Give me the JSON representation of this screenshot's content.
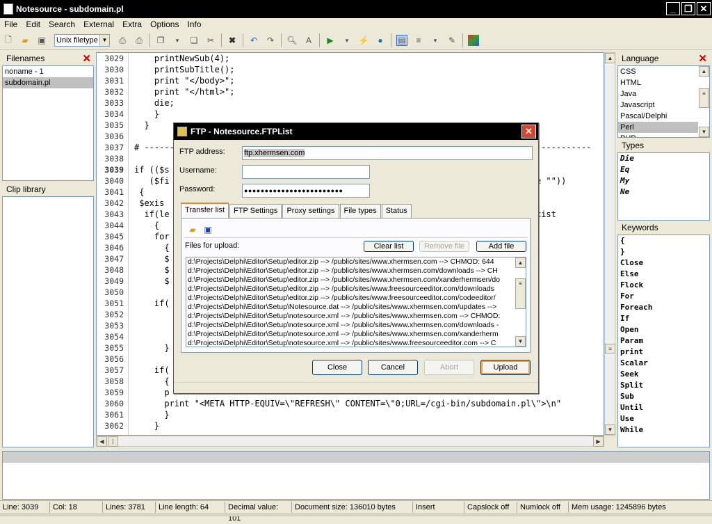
{
  "window": {
    "title": "Notesource - subdomain.pl"
  },
  "menu": [
    "File",
    "Edit",
    "Search",
    "External",
    "Extra",
    "Options",
    "Info"
  ],
  "toolbar": {
    "filetype": "Unix filetype"
  },
  "filenames": {
    "title": "Filenames",
    "items": [
      "noname - 1",
      "subdomain.pl"
    ],
    "selected": 1
  },
  "clip_library": {
    "title": "Clip library"
  },
  "language": {
    "title": "Language",
    "items": [
      "CSS",
      "HTML",
      "Java",
      "Javascript",
      "Pascal/Delphi",
      "Perl",
      "PHP"
    ],
    "selected": 5
  },
  "types": {
    "title": "Types",
    "items": [
      "Die",
      "Eq",
      "My",
      "Ne"
    ]
  },
  "keywords": {
    "title": "Keywords",
    "items": [
      "{",
      "}",
      "Close",
      "Else",
      "Flock",
      "For",
      "Foreach",
      "If",
      "Open",
      "Param",
      "print",
      "Scalar",
      "Seek",
      "Split",
      "Sub",
      "Until",
      "Use",
      "While"
    ]
  },
  "editor": {
    "line_numbers": [
      "3029",
      "3030",
      "3031",
      "3032",
      "3033",
      "3034",
      "3035",
      "3036",
      "3037",
      "3038",
      "3039",
      "3040",
      "3041",
      "3042",
      "3043",
      "3044",
      "3045",
      "3046",
      "3047",
      "3048",
      "3049",
      "3050",
      "3051",
      "3052",
      "3053",
      "3054",
      "3055",
      "3056",
      "3057",
      "3058",
      "3059",
      "3060",
      "3061",
      "3062"
    ],
    "lines": [
      "    printNewSub(4);",
      "    printSubTitle();",
      "    print \"</body>\";",
      "    print \"</html>\";",
      "    die;",
      "    }",
      "  }",
      "",
      "# -----------------------------------------------------------------------------------------",
      "",
      "if (($s                                                                                   ",
      "   ($fi                                                                    rto ne \"\"))",
      " {",
      " $exis",
      "  if(le                                                                 omain, exist",
      "    {",
      "    for",
      "      {",
      "      $",
      "      $",
      "      $",
      "",
      "    if(",
      "",
      "",
      "",
      "      }",
      "",
      "    if(",
      "      {",
      "      p",
      "      print \"<META HTTP-EQUIV=\\\"REFRESH\\\" CONTENT=\\\"0;URL=/cgi-bin/subdomain.pl\\\">\\n\"",
      "      }",
      "    }"
    ]
  },
  "status": {
    "line": "Line: 3039",
    "col": "Col: 18",
    "lines": "Lines: 3781",
    "line_length": "Line length: 64",
    "decimal": "Decimal value: 101",
    "doc_size": "Document size: 136010 bytes",
    "mode": "Insert",
    "capslock": "Capslock off",
    "numlock": "Numlock off",
    "mem": "Mem usage: 1245896 bytes"
  },
  "dialog": {
    "title": "FTP - Notesource.FTPList",
    "ftp_address_label": "FTP address:",
    "ftp_address_value": "ftp.xhermsen.com",
    "username_label": "Username:",
    "username_value": "",
    "password_label": "Password:",
    "password_value": "●●●●●●●●●●●●●●●●●●●●●●●●",
    "tabs": [
      "Transfer list",
      "FTP Settings",
      "Proxy settings",
      "File types",
      "Status"
    ],
    "files_label": "Files for upload:",
    "clear_list": "Clear list",
    "remove_file": "Remove file",
    "add_file": "Add file",
    "files": [
      "d:\\Projects\\Delphi\\Editor\\Setup\\editor.zip --> /public/sites/www.xhermsen.com --> CHMOD: 644",
      "d:\\Projects\\Delphi\\Editor\\Setup\\editor.zip --> /public/sites/www.xhermsen.com/downloads --> CH",
      "d:\\Projects\\Delphi\\Editor\\Setup\\editor.zip --> /public/sites/www.xhermsen.com/xanderhermsen/do",
      "d:\\Projects\\Delphi\\Editor\\Setup\\editor.zip --> /public/sites/www.freesourceeditor.com/downloads",
      "d:\\Projects\\Delphi\\Editor\\Setup\\editor.zip --> /public/sites/www.freesourceeditor.com/codeeditor/",
      "d:\\Projects\\Delphi\\Editor\\Setup\\Notesource.dat --> /public/sites/www.xhermsen.com/updates -->",
      "d:\\Projects\\Delphi\\Editor\\Setup\\notesource.xml --> /public/sites/www.xhermsen.com --> CHMOD:",
      "d:\\Projects\\Delphi\\Editor\\Setup\\notesource.xml --> /public/sites/www.xhermsen.com/downloads -",
      "d:\\Projects\\Delphi\\Editor\\Setup\\notesource.xml --> /public/sites/www.xhermsen.com/xanderherm",
      "d:\\Projects\\Delphi\\Editor\\Setup\\notesource.xml --> /public/sites/www.freesourceeditor.com --> C"
    ],
    "close": "Close",
    "cancel": "Cancel",
    "abort": "Abort",
    "upload": "Upload"
  }
}
